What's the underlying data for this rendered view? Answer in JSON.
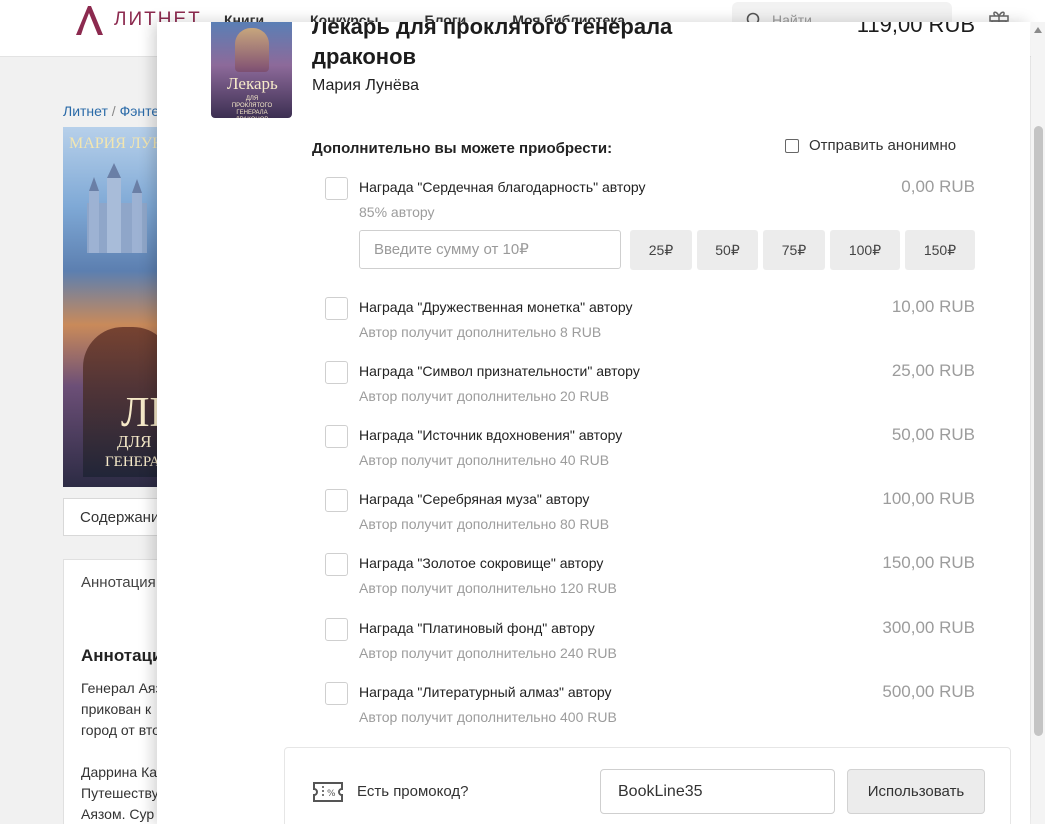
{
  "header": {
    "logo_text": "ЛИТНЕТ",
    "nav": [
      "Книги",
      "Конкурсы",
      "Блоги",
      "Моя библиотека"
    ],
    "search_placeholder": "Найти"
  },
  "background": {
    "breadcrumb": [
      "Литнет",
      "Фэнтези"
    ],
    "cover_author": "МАРИЯ ЛУНЁВА",
    "cover_title_line1": "ЛЕ",
    "cover_title_line2": "ДЛЯ",
    "cover_title_line3": "ГЕНЕРА",
    "contents_label": "Содержание",
    "annotation_tab": "Аннотация",
    "annotation_heading": "Аннотация",
    "annotation_lines": [
      "Генерал Аяз",
      "прикован к",
      "город от вто",
      "",
      "Даррина Ка",
      "Путешеству",
      "Аязом. Сур"
    ]
  },
  "modal": {
    "cover_title": "Лекарь",
    "cover_subtitle": "ДЛЯ ПРОКЛЯТОГО ГЕНЕРАЛА ДРАКОНОВ",
    "book_title": "Лекарь для проклятого генерала драконов",
    "author": "Мария Лунёва",
    "price": "119,00 RUB",
    "extras_heading": "Дополнительно вы можете приобрести:",
    "anonymous_label": "Отправить анонимно",
    "custom": {
      "placeholder": "Введите сумму от 10₽",
      "chips": [
        "25₽",
        "50₽",
        "75₽",
        "100₽",
        "150₽"
      ]
    },
    "rewards": [
      {
        "name": "Награда \"Сердечная благодарность\" автору",
        "note": "85% автору",
        "amount": "0,00 RUB"
      },
      {
        "name": "Награда \"Дружественная монетка\" автору",
        "note": "Автор получит дополнительно 8 RUB",
        "amount": "10,00 RUB"
      },
      {
        "name": "Награда \"Символ признательности\" автору",
        "note": "Автор получит дополнительно 20 RUB",
        "amount": "25,00 RUB"
      },
      {
        "name": "Награда \"Источник вдохновения\" автору",
        "note": "Автор получит дополнительно 40 RUB",
        "amount": "50,00 RUB"
      },
      {
        "name": "Награда \"Серебряная муза\" автору",
        "note": "Автор получит дополнительно 80 RUB",
        "amount": "100,00 RUB"
      },
      {
        "name": "Награда \"Золотое сокровище\" автору",
        "note": "Автор получит дополнительно 120 RUB",
        "amount": "150,00 RUB"
      },
      {
        "name": "Награда \"Платиновый фонд\" автору",
        "note": "Автор получит дополнительно 240 RUB",
        "amount": "300,00 RUB"
      },
      {
        "name": "Награда \"Литературный алмаз\" автору",
        "note": "Автор получит дополнительно 400 RUB",
        "amount": "500,00 RUB"
      }
    ],
    "promo": {
      "label": "Есть промокод?",
      "value": "BookLine35",
      "button": "Использовать"
    }
  },
  "icons": {
    "search": "search-icon",
    "gift": "gift-icon",
    "ticket": "ticket-icon",
    "chevron": "chevron-down-icon"
  },
  "colors": {
    "brand": "#8c2a4f",
    "link": "#2a6aa8",
    "muted": "#9c9c9c"
  }
}
